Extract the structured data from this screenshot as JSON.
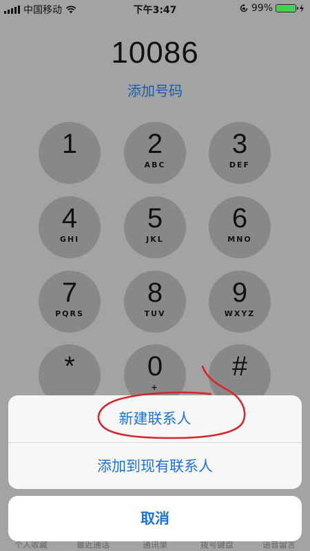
{
  "status_bar": {
    "carrier": "中国移动",
    "time": "下午3:47",
    "battery_percent": "99%",
    "battery_level": 0.99,
    "icons": [
      "signal-icon",
      "wifi-icon",
      "rotation-lock-icon",
      "battery-icon",
      "charging-icon"
    ]
  },
  "dialer": {
    "number": "10086",
    "add_number": "添加号码"
  },
  "keypad": [
    {
      "digit": "1",
      "letters": ""
    },
    {
      "digit": "2",
      "letters": "ABC"
    },
    {
      "digit": "3",
      "letters": "DEF"
    },
    {
      "digit": "4",
      "letters": "GHI"
    },
    {
      "digit": "5",
      "letters": "JKL"
    },
    {
      "digit": "6",
      "letters": "MNO"
    },
    {
      "digit": "7",
      "letters": "PQRS"
    },
    {
      "digit": "8",
      "letters": "TUV"
    },
    {
      "digit": "9",
      "letters": "WXYZ"
    },
    {
      "digit": "*",
      "letters": ""
    },
    {
      "digit": "0",
      "letters": "+"
    },
    {
      "digit": "#",
      "letters": ""
    }
  ],
  "tab_bar": [
    "个人收藏",
    "最近通话",
    "通讯录",
    "拨号键盘",
    "语音留言"
  ],
  "action_sheet": {
    "create_new_contact": "新建联系人",
    "add_to_existing": "添加到现有联系人",
    "cancel": "取消"
  },
  "colors": {
    "accent": "#1a73d9",
    "annotation": "#d8252a"
  }
}
